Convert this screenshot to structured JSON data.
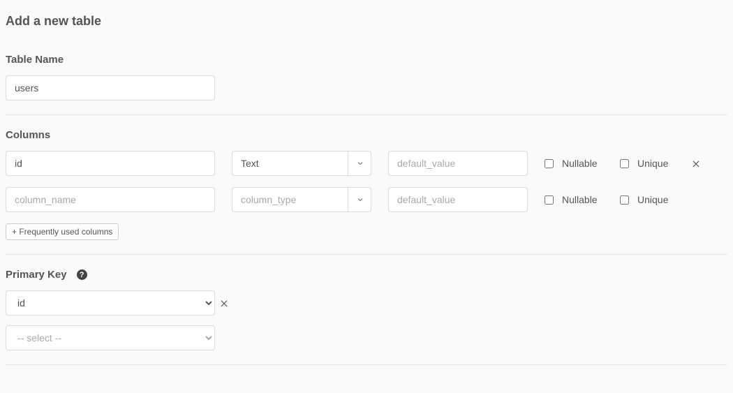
{
  "page_title": "Add a new table",
  "table_name": {
    "label": "Table Name",
    "value": "users"
  },
  "columns": {
    "label": "Columns",
    "rows": [
      {
        "name": "id",
        "name_placeholder": "column_name",
        "type": "Text",
        "type_placeholder": "column_type",
        "default_placeholder": "default_value",
        "nullable_label": "Nullable",
        "unique_label": "Unique",
        "removable": true
      },
      {
        "name": "",
        "name_placeholder": "column_name",
        "type": "",
        "type_placeholder": "column_type",
        "default_placeholder": "default_value",
        "nullable_label": "Nullable",
        "unique_label": "Unique",
        "removable": false
      }
    ],
    "frequently_used_label": "+ Frequently used columns"
  },
  "primary_key": {
    "label": "Primary Key",
    "rows": [
      {
        "value": "id",
        "placeholder": false,
        "removable": true
      },
      {
        "value": "-- select --",
        "placeholder": true,
        "removable": false
      }
    ]
  }
}
